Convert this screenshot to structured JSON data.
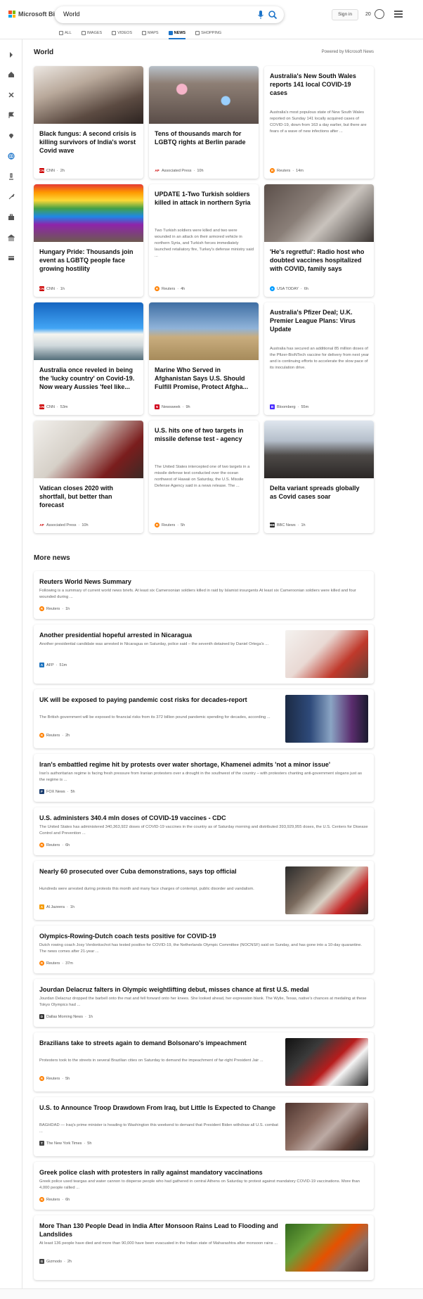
{
  "header": {
    "logo_text": "Microsoft Bing",
    "search_value": "World",
    "sign_in": "Sign in",
    "points": "20",
    "tabs": [
      {
        "label": "ALL",
        "icon": "search-icon"
      },
      {
        "label": "IMAGES",
        "icon": "image-icon"
      },
      {
        "label": "VIDEOS",
        "icon": "video-icon"
      },
      {
        "label": "MAPS",
        "icon": "map-pin-icon"
      },
      {
        "label": "NEWS",
        "icon": "news-icon",
        "active": true
      },
      {
        "label": "SHOPPING",
        "icon": "tag-icon"
      }
    ]
  },
  "colors": {
    "accent": "#1a73c9",
    "cnn": "#cc0000",
    "reuters": "#ff8000",
    "usatoday": "#009bff",
    "bloomberg": "#472aff",
    "newsweek": "#d0021b"
  },
  "section": {
    "title": "World",
    "powered_by": "Powered by Microsoft News"
  },
  "cards": [
    {
      "title": "Black fungus: A second crisis is killing survivors of India's worst Covid wave",
      "source": "CNN",
      "time": "2h",
      "has_image": true
    },
    {
      "title": "Tens of thousands march for LGBTQ rights at Berlin parade",
      "source": "Associated Press",
      "time": "10h",
      "has_image": true
    },
    {
      "title": "Australia's New South Wales reports 141 local COVID-19 cases",
      "snippet": "Australia's most populous state of New South Wales reported on Sunday 141 locally acquired cases of COVID-19, down from 163 a day earlier, but there are fears of a wave of new infections after ...",
      "source": "Reuters",
      "time": "14m",
      "has_image": false
    },
    {
      "title": "Hungary Pride: Thousands join event as LGBTQ people face growing hostility",
      "source": "CNN",
      "time": "1h",
      "has_image": true
    },
    {
      "title": "UPDATE 1-Two Turkish soldiers killed in attack in northern Syria",
      "snippet": "Two Turkish soldiers were killed and two were wounded in an attack on their armored vehicle in northern Syria, and Turkish forces immediately launched retaliatory fire, Turkey's defense ministry said ...",
      "source": "Reuters",
      "time": "4h",
      "has_image": false
    },
    {
      "title": "'He's regretful': Radio host who doubted vaccines hospitalized with COVID, family says",
      "source": "USA TODAY",
      "time": "6h",
      "has_image": true
    },
    {
      "title": "Australia once reveled in being the 'lucky country' on Covid-19. Now weary Aussies 'feel like...",
      "source": "CNN",
      "time": "53m",
      "has_image": true
    },
    {
      "title": "Marine Who Served in Afghanistan Says U.S. Should Fulfill Promise, Protect Afgha...",
      "source": "Newsweek",
      "time": "9h",
      "has_image": true
    },
    {
      "title": "Australia's Pfizer Deal; U.K. Premier League Plans: Virus Update",
      "snippet": "Australia has secured an additional 85 million doses of the Pfizer-BioNTech vaccine for delivery from next year and is continuing efforts to accelerate the slow pace of its inoculation drive.",
      "source": "Bloomberg",
      "time": "55m",
      "has_image": false
    },
    {
      "title": "Vatican closes 2020 with shortfall, but better than forecast",
      "source": "Associated Press",
      "time": "10h",
      "has_image": true
    },
    {
      "title": "U.S. hits one of two targets in missile defense test - agency",
      "snippet": "The United States intercepted one of two targets in a missile defense test conducted over the ocean northwest of Hawaii on Saturday, the U.S. Missile Defense Agency said in a news release. The ...",
      "source": "Reuters",
      "time": "5h",
      "has_image": false
    },
    {
      "title": "Delta variant spreads globally as Covid cases soar",
      "source": "BBC News",
      "time": "1h",
      "has_image": true
    }
  ],
  "more": {
    "title": "More news",
    "items": [
      {
        "title": "Reuters World News Summary",
        "snippet": "Following is a summary of current world news briefs. At least six Cameroonian soldiers killed in raid by Islamist insurgents At least six Cameroonian soldiers were killed and four wounded during ...",
        "source": "Reuters",
        "time": "1h"
      },
      {
        "title": "Another presidential hopeful arrested in Nicaragua",
        "snippet": "Another presidential candidate was arrested in Nicaragua on Saturday, police said – the seventh detained by Daniel Ortega's ...",
        "source": "AFP",
        "time": "51m"
      },
      {
        "title": "UK will be exposed to paying pandemic cost risks for decades-report",
        "snippet": "The British government will be exposed to financial risks from its 372 billion pound pandemic spending for decades, according ...",
        "source": "Reuters",
        "time": "2h"
      },
      {
        "title": "Iran's embattled regime hit by protests over water shortage, Khamenei admits 'not a minor issue'",
        "snippet": "Iran's authoritarian regime is facing fresh pressure from Iranian protesters over a drought in the southwest of the country – with protesters chanting anti-government slogans just as the regime is ...",
        "source": "FOX News",
        "time": "5h"
      },
      {
        "title": "U.S. administers 340.4 mln doses of COVID-19 vaccines - CDC",
        "snippet": "The United States has administered 340,363,922 doses of COVID-19 vaccines in the country as of Saturday morning and distributed 393,929,955 doses, the U.S. Centers for Disease Control and Prevention ...",
        "source": "Reuters",
        "time": "6h"
      },
      {
        "title": "Nearly 60 prosecuted over Cuba demonstrations, says top official",
        "snippet": "Hundreds were arrested during protests this month and many face charges of contempt, public disorder and vandalism.",
        "source": "Al Jazeera",
        "time": "1h"
      },
      {
        "title": "Olympics-Rowing-Dutch coach tests positive for COVID-19",
        "snippet": "Dutch rowing coach Josy Verdonkschot has tested positive for COVID-19, the Netherlands Olympic Committee (NOCNSF) said on Sunday, and has gone into a 10-day quarantine. The news comes after 21-year ...",
        "source": "Reuters",
        "time": "37m"
      },
      {
        "title": "Jourdan Delacruz falters in Olympic weightlifting debut, misses chance at first U.S. medal",
        "snippet": "Jourdan Delacruz dropped the barbell onto the mat and fell forward onto her knees. She looked ahead, her expression blank. The Wylie, Texas, native's chances at medaling at these Tokyo Olympics had ...",
        "source": "Dallas Morning News",
        "time": "1h"
      },
      {
        "title": "Brazilians take to streets again to demand Bolsonaro's impeachment",
        "snippet": "Protesters took to the streets in several Brazilian cities on Saturday to demand the impeachment of far-right President Jair ...",
        "source": "Reuters",
        "time": "5h"
      },
      {
        "title": "U.S. to Announce Troop Drawdown From Iraq, but Little Is Expected to Change",
        "snippet": "BAGHDAD — Iraq's prime minister is heading to Washington this weekend to demand that President Biden withdraw all U.S. combat ...",
        "source": "The New York Times",
        "time": "5h"
      },
      {
        "title": "Greek police clash with protesters in rally against mandatory vaccinations",
        "snippet": "Greek police used teargas and water cannon to disperse people who had gathered in central Athens on Saturday to protest against mandatory COVID-19 vaccinations. More than 4,000 people rallied ...",
        "source": "Reuters",
        "time": "6h"
      },
      {
        "title": "More Than 130 People Dead in India After Monsoon Rains Lead to Flooding and Landslides",
        "snippet": "At least 136 people have died and more than 90,000 have been evacuated in the Indian state of Maharashtra after monsoon rains ...",
        "source": "Gizmodo",
        "time": "2h"
      }
    ]
  }
}
